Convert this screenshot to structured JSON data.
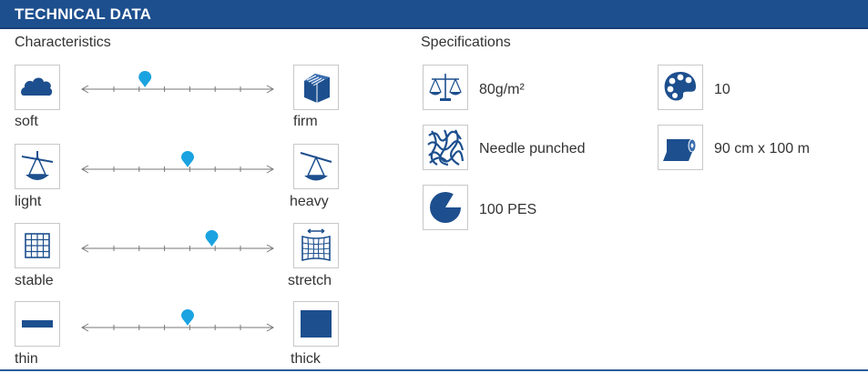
{
  "header": {
    "title": "TECHNICAL DATA"
  },
  "characteristics": {
    "title": "Characteristics",
    "scales": [
      {
        "left_label": "soft",
        "right_label": "firm",
        "left_icon": "cloud-icon",
        "right_icon": "stack-block-icon",
        "level": 0.2
      },
      {
        "left_label": "light",
        "right_label": "heavy",
        "left_icon": "scale-light-icon",
        "right_icon": "scale-heavy-icon",
        "level": 0.5
      },
      {
        "left_label": "stable",
        "right_label": "stretch",
        "left_icon": "grid-icon",
        "right_icon": "stretch-grid-icon",
        "level": 0.67
      },
      {
        "left_label": "thin",
        "right_label": "thick",
        "left_icon": "thin-bar-icon",
        "right_icon": "thick-block-icon",
        "level": 0.5
      }
    ]
  },
  "specifications": {
    "title": "Specifications",
    "items": [
      {
        "icon": "balance-scale-icon",
        "value": "80g/m²"
      },
      {
        "icon": "fiber-pattern-icon",
        "value": "Needle punched"
      },
      {
        "icon": "pie-chart-icon",
        "value": "100 PES"
      },
      {
        "icon": "color-palette-icon",
        "value": "10"
      },
      {
        "icon": "roll-icon",
        "value": "90 cm x 100 m"
      }
    ]
  },
  "colors": {
    "brand": "#1d4f8e",
    "marker": "#1aa3e0"
  }
}
